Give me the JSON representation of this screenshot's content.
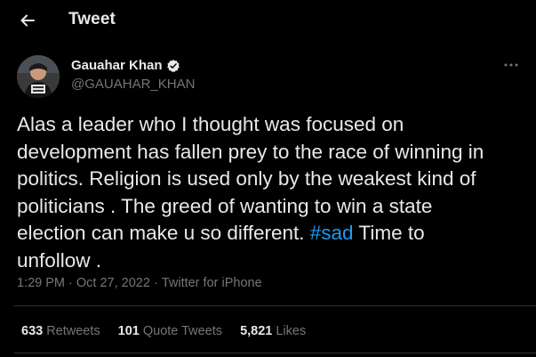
{
  "header": {
    "back_icon": "arrow-left-icon",
    "title": "Tweet"
  },
  "tweet": {
    "author_name": "Gauahar Khan",
    "author_handle": "@GAUAHAR_KHAN",
    "verified": true,
    "text_before_hashtag": "Alas a leader who I thought was focused on\ndevelopment has fallen prey to the race of winning in\npolitics. Religion is used only by the weakest kind of\npoliticians . The greed of wanting to win a state\nelection can make u so different. ",
    "hashtag": "#sad",
    "text_after_hashtag": " Time to\nunfollow .",
    "time": "1:29 PM",
    "date": "Oct 27, 2022",
    "source": "Twitter for iPhone"
  },
  "stats": {
    "retweets_count": "633",
    "retweets_label": "Retweets",
    "quotes_count": "101",
    "quotes_label": "Quote Tweets",
    "likes_count": "5,821",
    "likes_label": "Likes"
  },
  "colors": {
    "background": "#000000",
    "text": "#e7e9ea",
    "secondary": "#71767b",
    "accent": "#1d9bf0",
    "divider": "#2f3336"
  }
}
